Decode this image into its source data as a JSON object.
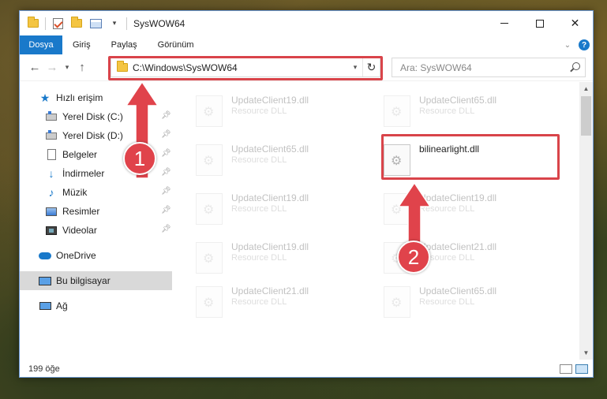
{
  "window": {
    "title": "SysWOW64"
  },
  "ribbon": {
    "tabs": [
      "Dosya",
      "Giriş",
      "Paylaş",
      "Görünüm"
    ],
    "help": "?"
  },
  "nav": {
    "back": "←",
    "forward": "→",
    "recent": "▾",
    "up": "↑"
  },
  "address": {
    "path": "C:\\Windows\\SysWOW64"
  },
  "search": {
    "placeholder": "Ara: SysWOW64"
  },
  "sidebar": {
    "items": [
      {
        "label": "Hızlı erişim",
        "icon": "star-icon"
      },
      {
        "label": "Yerel Disk (C:)",
        "icon": "drive-icon",
        "pinned": true
      },
      {
        "label": "Yerel Disk (D:)",
        "icon": "drive-icon",
        "pinned": true
      },
      {
        "label": "Belgeler",
        "icon": "document-icon",
        "pinned": true
      },
      {
        "label": "İndirmeler",
        "icon": "download-icon",
        "pinned": true
      },
      {
        "label": "Müzik",
        "icon": "music-icon",
        "pinned": true
      },
      {
        "label": "Resimler",
        "icon": "pictures-icon",
        "pinned": true
      },
      {
        "label": "Videolar",
        "icon": "videos-icon",
        "pinned": true
      },
      {
        "label": "OneDrive",
        "icon": "cloud-icon"
      },
      {
        "label": "Bu bilgisayar",
        "icon": "computer-icon",
        "selected": true
      },
      {
        "label": "Ağ",
        "icon": "network-icon"
      }
    ]
  },
  "files": [
    {
      "name": "UpdateClient19.dll",
      "desc": "Resource DLL",
      "faded": true
    },
    {
      "name": "UpdateClient65.dll",
      "desc": "Resource DLL",
      "faded": true
    },
    {
      "name": "UpdateClient65.dll",
      "desc": "Resource DLL",
      "faded": true
    },
    {
      "name": "bilinearlight.dll",
      "desc": "",
      "faded": false
    },
    {
      "name": "UpdateClient19.dll",
      "desc": "Resource DLL",
      "faded": true
    },
    {
      "name": "UpdateClient19.dll",
      "desc": "Resource DLL",
      "faded": true
    },
    {
      "name": "UpdateClient19.dll",
      "desc": "Resource DLL",
      "faded": true
    },
    {
      "name": "UpdateClient21.dll",
      "desc": "Resource DLL",
      "faded": true
    },
    {
      "name": "UpdateClient21.dll",
      "desc": "Resource DLL",
      "faded": true
    },
    {
      "name": "UpdateClient65.dll",
      "desc": "Resource DLL",
      "faded": true
    }
  ],
  "status": {
    "count": "199 öğe"
  },
  "annotations": {
    "step1": "1",
    "step2": "2",
    "color": "#e0434b"
  }
}
